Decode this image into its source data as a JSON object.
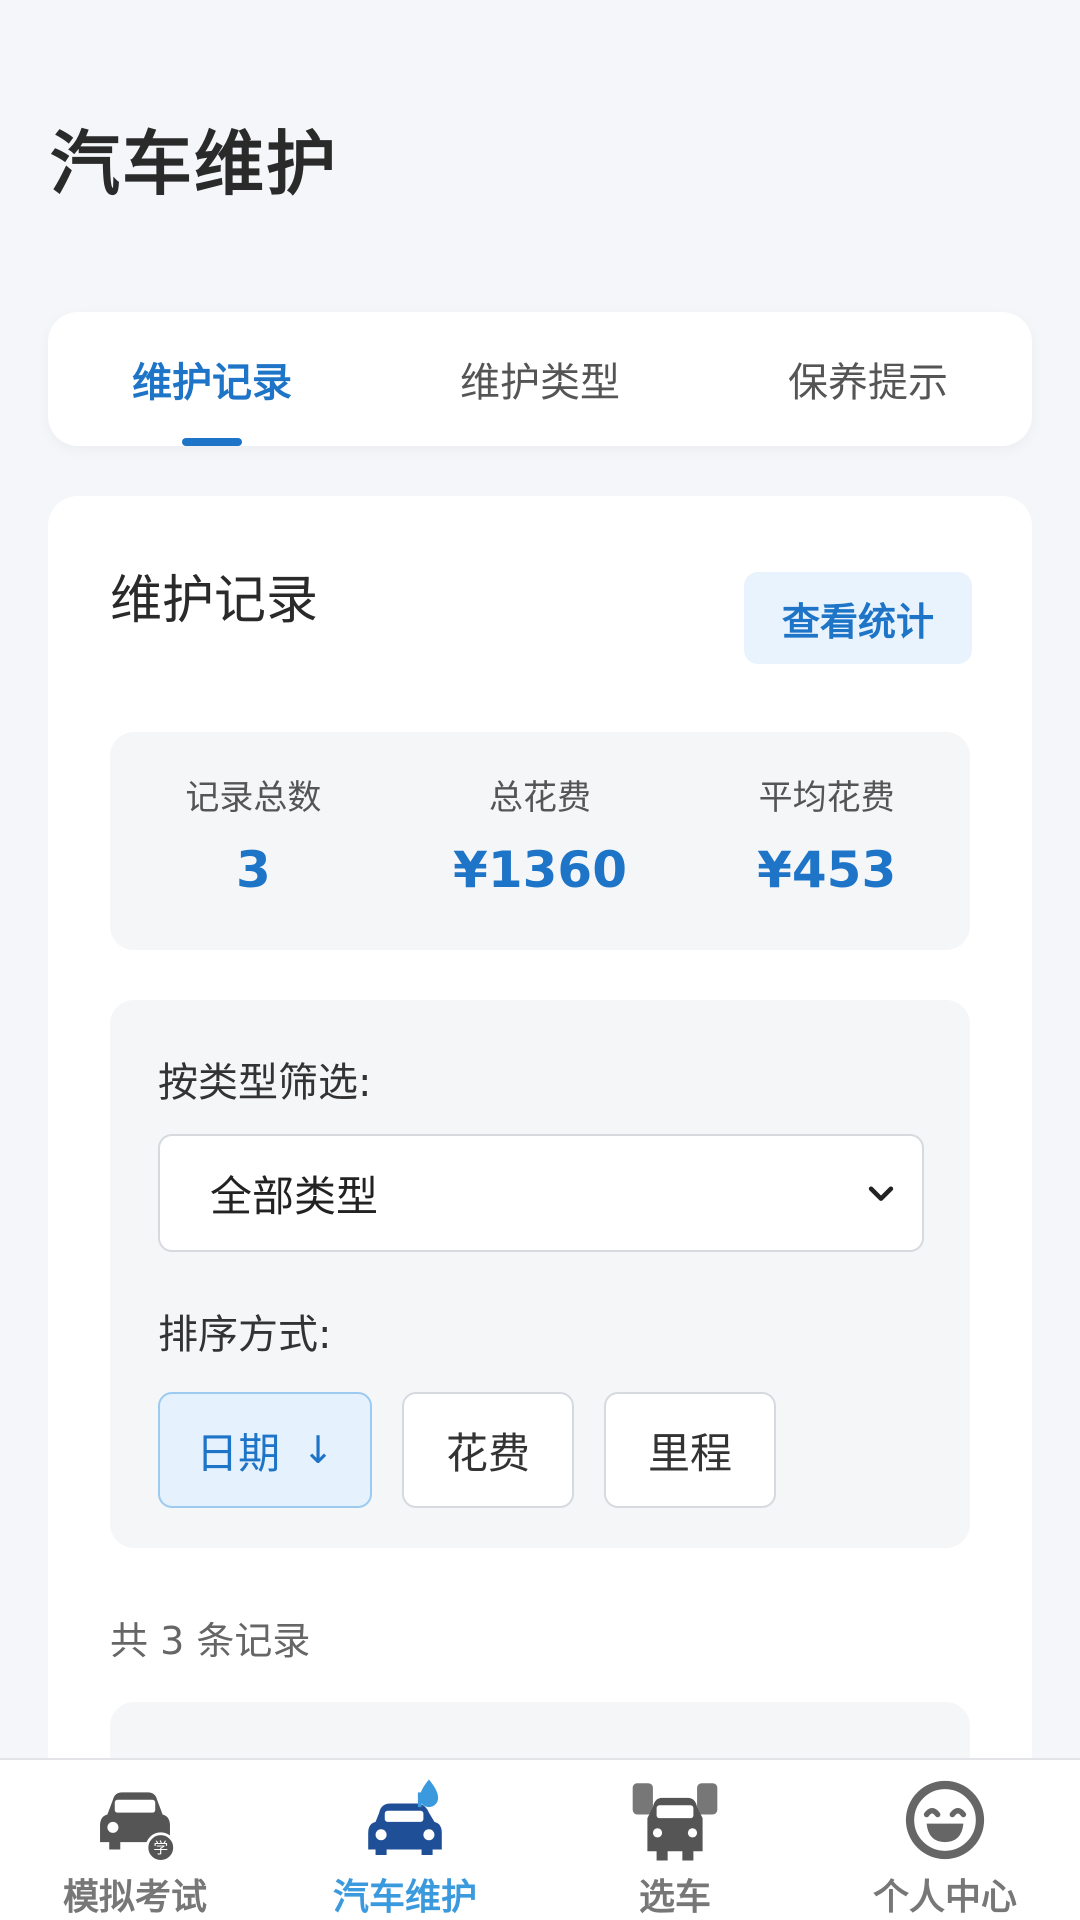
{
  "page": {
    "title": "汽车维护"
  },
  "tabs": [
    {
      "label": "维护记录",
      "active": true
    },
    {
      "label": "维护类型",
      "active": false
    },
    {
      "label": "保养提示",
      "active": false
    }
  ],
  "card": {
    "title": "维护记录",
    "stats_button": "查看统计"
  },
  "summary": [
    {
      "label": "记录总数",
      "value": "3"
    },
    {
      "label": "总花费",
      "value": "¥1360"
    },
    {
      "label": "平均花费",
      "value": "¥453"
    }
  ],
  "filter": {
    "type_label": "按类型筛选:",
    "type_selected": "全部类型",
    "sort_label": "排序方式:",
    "sort_options": [
      {
        "label": "日期",
        "arrow": "↓",
        "active": true
      },
      {
        "label": "花费",
        "arrow": "",
        "active": false
      },
      {
        "label": "里程",
        "arrow": "",
        "active": false
      }
    ]
  },
  "records": {
    "count_text": "共 3 条记录"
  },
  "tabbar": [
    {
      "label": "模拟考试",
      "icon": "car-study-icon",
      "active": false
    },
    {
      "label": "汽车维护",
      "icon": "car-maintenance-icon",
      "active": true
    },
    {
      "label": "选车",
      "icon": "car-select-icon",
      "active": false
    },
    {
      "label": "个人中心",
      "icon": "smiley-face-icon",
      "active": false
    }
  ],
  "colors": {
    "accent": "#1e74c7",
    "tab_active": "#3b9ade",
    "background": "#f4f6fa"
  }
}
